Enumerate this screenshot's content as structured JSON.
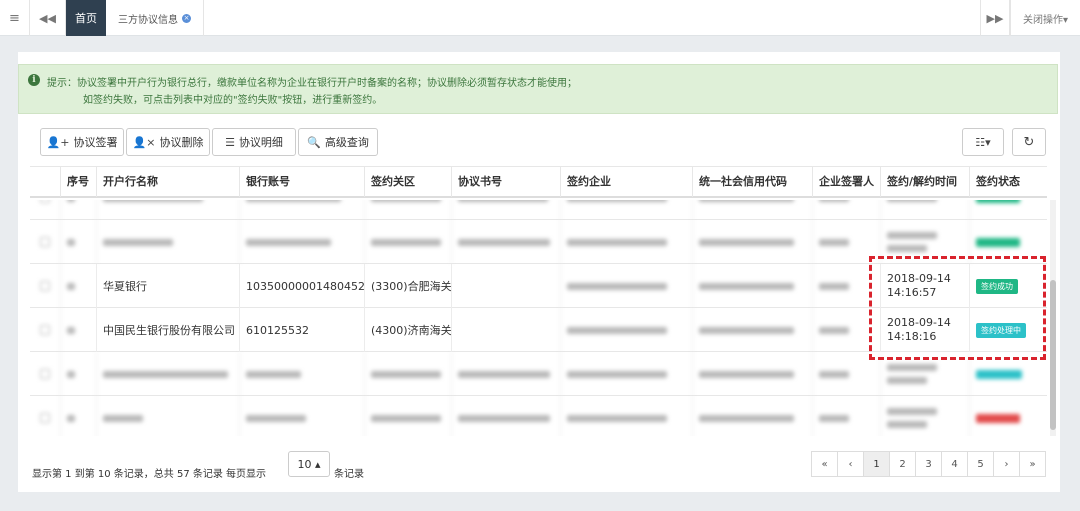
{
  "topbar": {
    "menu_icon": "menu-icon",
    "back_icon": "double-left-icon",
    "forward_icon": "double-right-icon",
    "tabs": [
      {
        "label": "首页",
        "active": true
      },
      {
        "label": "三方协议信息",
        "closable": true
      }
    ],
    "close_ops_label": "关闭操作▾"
  },
  "alert": {
    "line1": "提示：协议签署中开户行为银行总行，缴款单位名称为企业在银行开户时备案的名称；协议删除必须暂存状态才能使用；",
    "line2": "如签约失败，可点击列表中对应的\"签约失败\"按钮，进行重新签约。"
  },
  "toolbar": {
    "sign_label": "协议签署",
    "delete_label": "协议删除",
    "detail_label": "协议明细",
    "search_label": "高级查询",
    "columns_icon": "list-columns-icon",
    "refresh_icon": "refresh-icon"
  },
  "table": {
    "columns": [
      "序号",
      "开户行名称",
      "银行账号",
      "签约关区",
      "协议书号",
      "签约企业",
      "统一社会信用代码",
      "企业签署人",
      "签约/解约时间",
      "签约状态"
    ],
    "rows": [
      {
        "bank": "华夏银行",
        "account": "10350000001480452",
        "customs": "(3300)合肥海关",
        "time_date": "2018-09-14",
        "time_clock": "14:16:57",
        "status": "签约成功"
      },
      {
        "bank": "中国民生银行股份有限公司",
        "account": "610125532",
        "customs": "(4300)济南海关",
        "time_date": "2018-09-14",
        "time_clock": "14:18:16",
        "status": "签约处理中"
      }
    ]
  },
  "colors": {
    "success": "#1fb785",
    "processing": "#2cc1c8",
    "failed": "#e24a4a",
    "highlight": "#d9232d",
    "tab_active": "#2f4050"
  },
  "footer": {
    "summary": "显示第 1 到第 10 条记录，总共 57 条记录 每页显示",
    "page_size": "10 ▴",
    "suffix": "条记录",
    "pages": [
      "«",
      "‹",
      "1",
      "2",
      "3",
      "4",
      "5",
      "›",
      "»"
    ],
    "current_page": "1"
  }
}
